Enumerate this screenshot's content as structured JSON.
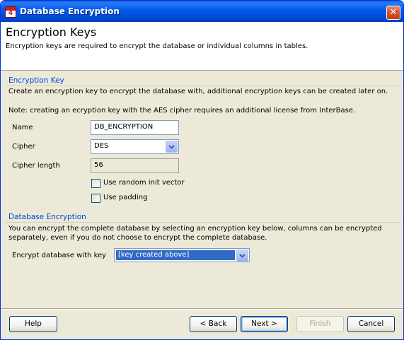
{
  "window": {
    "title": "Database Encryption",
    "close_symbol": "✕"
  },
  "header": {
    "title": "Encryption Keys",
    "subtitle": "Encryption keys are required to encrypt the database or individual columns in tables."
  },
  "encryption_key": {
    "section_title": "Encryption Key",
    "description": "Create an encryption key to encrypt the database with, additional encryption keys can be created later on.",
    "note": "Note: creating an ecryption key with the AES cipher requires an additional license from InterBase.",
    "name_label": "Name",
    "name_value": "DB_ENCRYPTION",
    "cipher_label": "Cipher",
    "cipher_value": "DES",
    "cipher_length_label": "Cipher length",
    "cipher_length_value": "56",
    "random_init_vector_label": "Use random init vector",
    "random_init_vector_checked": false,
    "padding_label": "Use padding",
    "padding_checked": false
  },
  "database_encryption": {
    "section_title": "Database Encryption",
    "description_line1": "You can encrypt the complete database by selecting an encryption key below, columns can be encrypted",
    "description_line2": "separately, even if you do not choose to encrypt the complete database.",
    "encrypt_label": "Encrypt database with key",
    "encrypt_value": "[key created above]"
  },
  "buttons": {
    "help": "Help",
    "back": "< Back",
    "next": "Next >",
    "finish": "Finish",
    "cancel": "Cancel"
  },
  "icons": {
    "app": "app-4-icon",
    "close": "close-icon",
    "dropdown": "chevron-down-icon"
  },
  "colors": {
    "titlebar": "#0058ee",
    "section_title": "#0046d5",
    "selection": "#316ac5",
    "dialog_bg": "#ece9d8"
  }
}
